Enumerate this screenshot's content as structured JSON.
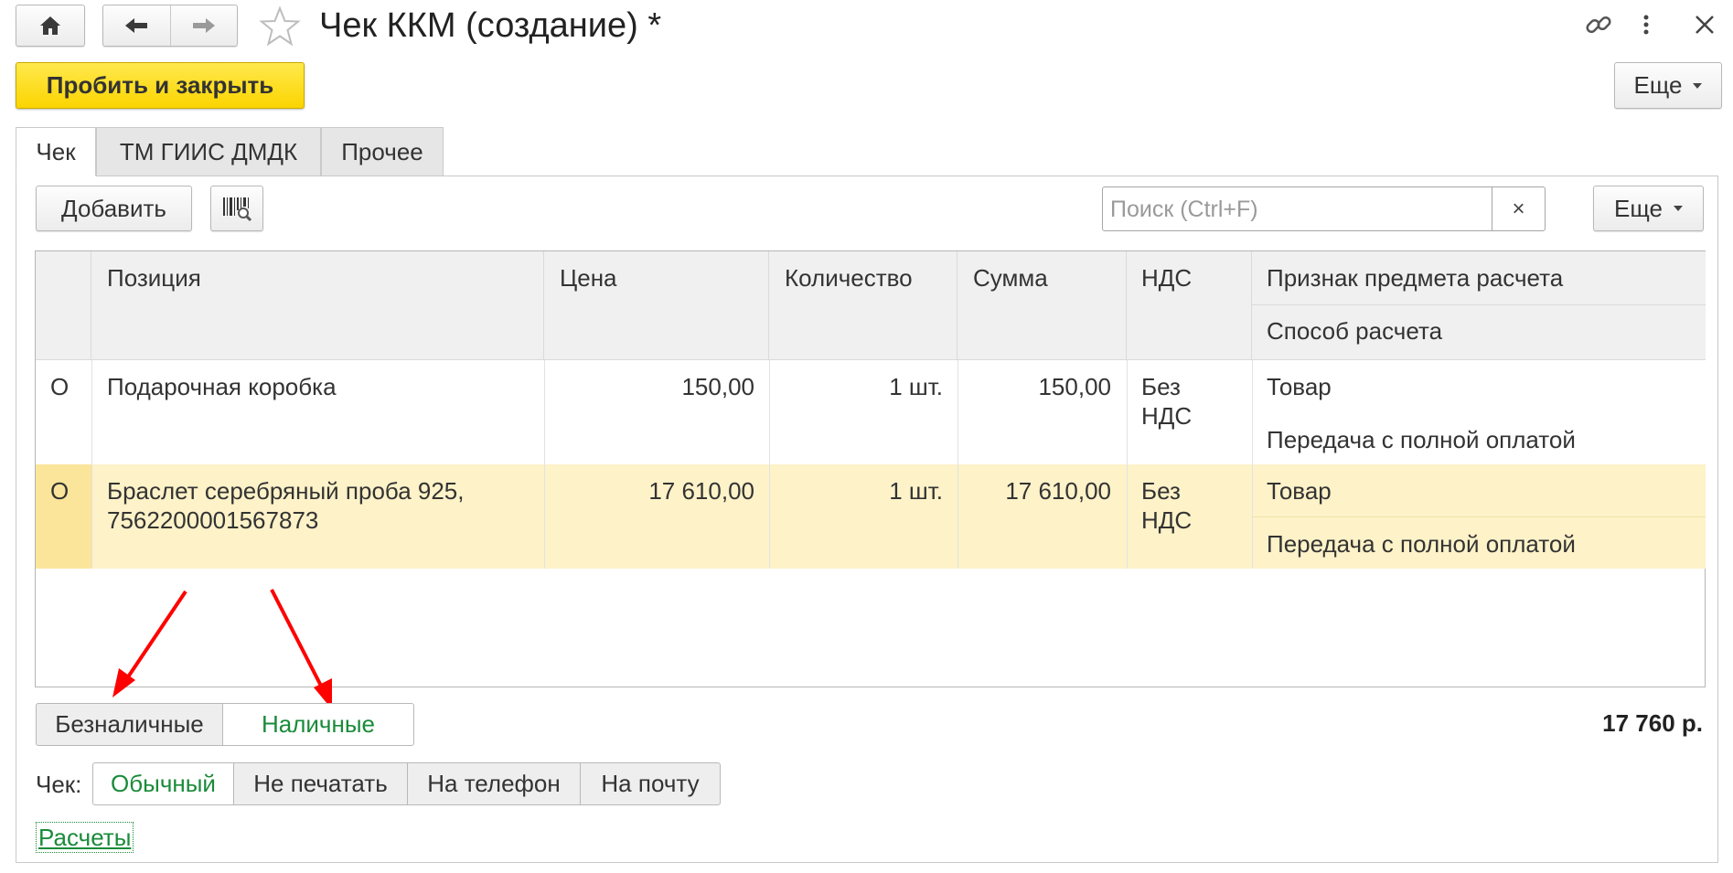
{
  "window": {
    "title": "Чек ККМ (создание) *",
    "home_icon": "home-icon",
    "back_icon": "arrow-left-icon",
    "forward_icon": "arrow-right-icon",
    "favorite_icon": "star-icon",
    "link_icon": "link-icon",
    "menu_icon": "kebab-menu-icon",
    "close_icon": "close-icon"
  },
  "commandbar": {
    "primary_label": "Пробить и закрыть",
    "more_label": "Еще"
  },
  "tabs": [
    {
      "label": "Чек",
      "active": true
    },
    {
      "label": "ТМ ГИИС ДМДК",
      "active": false
    },
    {
      "label": "Прочее",
      "active": false
    }
  ],
  "toolbar": {
    "add_label": "Добавить",
    "barcode_icon": "barcode-search-icon",
    "search_placeholder": "Поиск (Ctrl+F)",
    "search_clear": "×",
    "more_label": "Еще"
  },
  "table": {
    "columns": {
      "position": "Позиция",
      "price": "Цена",
      "qty": "Количество",
      "sum": "Сумма",
      "vat": "НДС",
      "sign": "Признак предмета расчета",
      "method": "Способ расчета"
    },
    "rows": [
      {
        "mark": "O",
        "position": "Подарочная коробка",
        "price": "150,00",
        "qty": "1 шт.",
        "sum": "150,00",
        "vat_line1": "Без",
        "vat_line2": "НДС",
        "sign": "Товар",
        "method": "Передача с полной оплатой",
        "selected": false
      },
      {
        "mark": "O",
        "position_line1": "Браслет серебряный проба 925,",
        "position_line2": "7562200001567873",
        "price": "17 610,00",
        "qty": "1 шт.",
        "sum": "17 610,00",
        "vat_line1": "Без",
        "vat_line2": "НДС",
        "sign": "Товар",
        "method": "Передача с полной оплатой",
        "selected": true
      }
    ]
  },
  "payment": {
    "options": [
      "Безналичные",
      "Наличные"
    ],
    "selected": "Наличные",
    "total": "17 760 р."
  },
  "receipt": {
    "label": "Чек:",
    "options": [
      "Обычный",
      "Не печатать",
      "На телефон",
      "На почту"
    ],
    "selected": "Обычный"
  },
  "links": {
    "payments": "Расчеты"
  },
  "colors": {
    "accent_yellow": "#fbd400",
    "selected_row": "#fdf2c8",
    "green": "#1a8b3a",
    "annotation_red": "#ff0000"
  }
}
